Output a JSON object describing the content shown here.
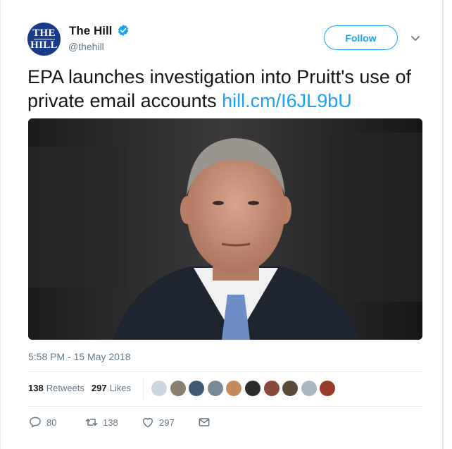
{
  "author": {
    "name": "The Hill",
    "handle": "@thehill",
    "avatar_line1": "THE",
    "avatar_line2": "HILL",
    "verified": true
  },
  "header": {
    "follow_label": "Follow",
    "more_icon": "chevron-down-icon"
  },
  "tweet": {
    "text": "EPA launches investigation into Pruitt's use of private email accounts",
    "link": "hill.cm/I6JL9bU",
    "media_icon": "photo-portrait-man-suit"
  },
  "meta": {
    "timestamp": "5:58 PM - 15 May 2018",
    "retweet_count": "138",
    "retweet_label": "Retweets",
    "like_count": "297",
    "like_label": "Likes"
  },
  "actions": {
    "reply_count": "80",
    "retweet_count": "138",
    "like_count": "297"
  },
  "colors": {
    "accent": "#1da1f2",
    "text": "#14171a",
    "muted": "#657786",
    "border": "#e6ecf0",
    "avatar_bg": "#1a3a8a"
  }
}
